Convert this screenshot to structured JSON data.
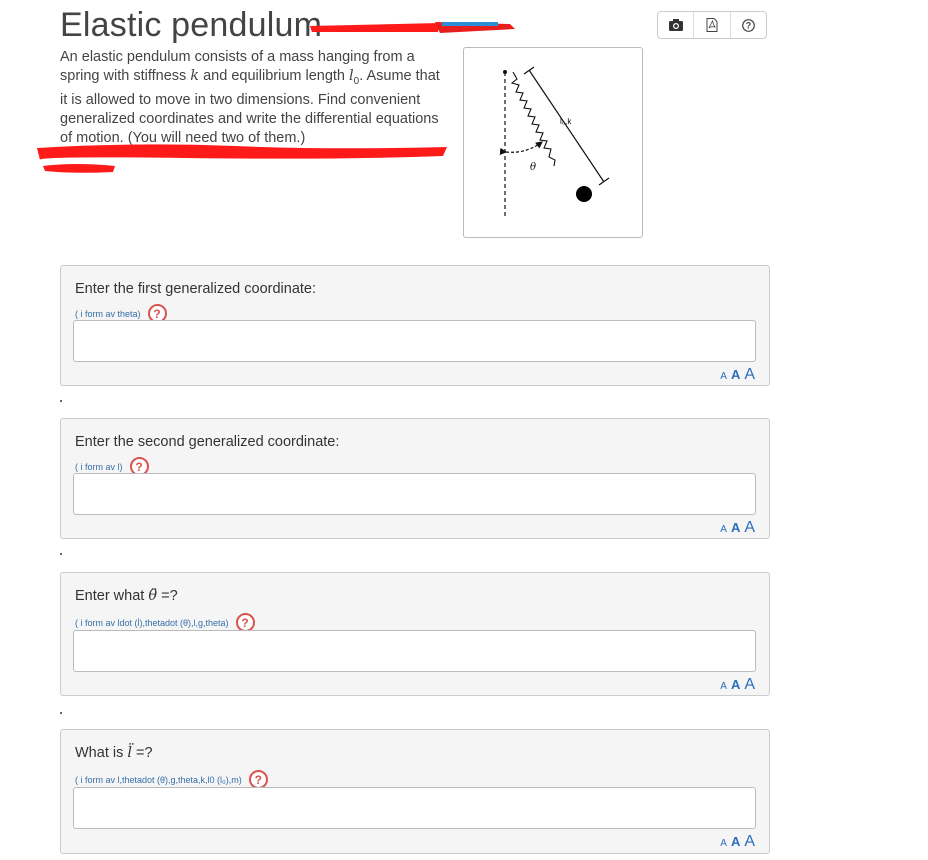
{
  "header": {
    "title": "Elastic pendulum",
    "toolbar": [
      {
        "icon": "camera-icon"
      },
      {
        "icon": "pdf-icon"
      },
      {
        "icon": "help-icon"
      }
    ]
  },
  "description": {
    "intro": "An elastic pendulum consists of a mass hanging from a spring with stiffness ",
    "k": "k",
    "mid": " and equilibrium length ",
    "l0": "l",
    "l0_sub": "0",
    "rest": ". Asume that it is allowed to move in two dimensions. Find convenient generalized coordinates and write the differential equations of motion. (You will need two of them.)"
  },
  "figure": {
    "spring_label": "l₀,k",
    "angle_label": "θ"
  },
  "questions": [
    {
      "prompt_pre": "Enter the first generalized coordinate:",
      "math": "",
      "prompt_post": "",
      "hint": "( i form av theta)"
    },
    {
      "prompt_pre": "Enter the second generalized coordinate:",
      "math": "",
      "prompt_post": "",
      "hint": "( i form av l)"
    },
    {
      "prompt_pre": "Enter what ",
      "math": "θ̈",
      "prompt_post": " =?",
      "hint": "( i form av ldot (l̇),thetadot (θ̇),l,g,theta)"
    },
    {
      "prompt_pre": "What is ",
      "math": "l̈",
      "prompt_post": " =?",
      "hint": "( i form av l,thetadot (θ̇),g,theta,k,l0 (l₀),m)"
    }
  ],
  "help_symbol": "?",
  "font_size_controls": [
    "A",
    "A",
    "A"
  ],
  "colors": {
    "accent": "#2a6ebb",
    "help": "#d9534f",
    "redaction": "#ff1a1a"
  }
}
